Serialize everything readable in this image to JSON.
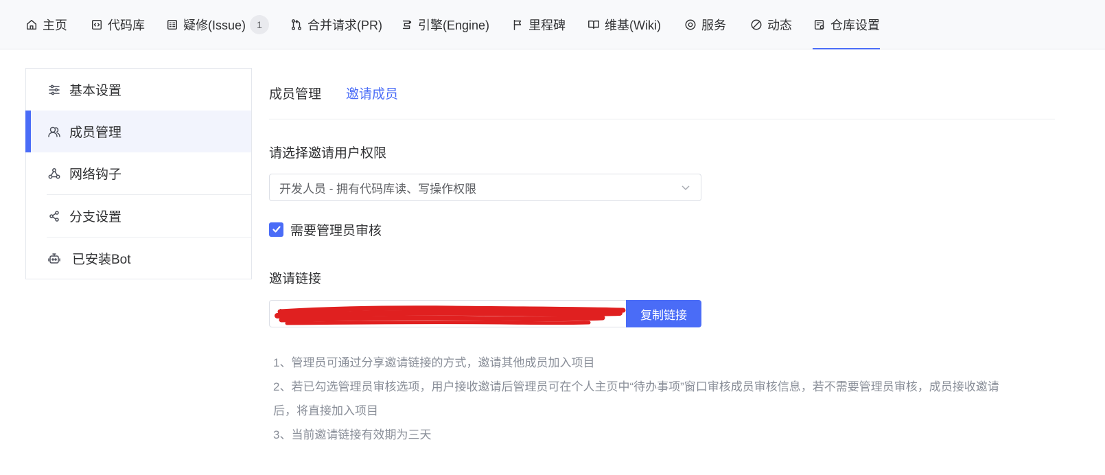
{
  "nav": {
    "items": [
      {
        "label": "主页",
        "icon": "home-icon"
      },
      {
        "label": "代码库",
        "icon": "code-icon"
      },
      {
        "label": "疑修(Issue)",
        "icon": "issue-icon",
        "badge": "1"
      },
      {
        "label": "合并请求(PR)",
        "icon": "pull-request-icon"
      },
      {
        "label": "引擎(Engine)",
        "icon": "engine-icon"
      },
      {
        "label": "里程碑",
        "icon": "flag-icon"
      },
      {
        "label": "维基(Wiki)",
        "icon": "book-icon"
      },
      {
        "label": "服务",
        "icon": "service-icon"
      },
      {
        "label": "动态",
        "icon": "activity-icon"
      },
      {
        "label": "仓库设置",
        "icon": "settings-icon",
        "active": true
      }
    ]
  },
  "sidebar": {
    "items": [
      {
        "label": "基本设置",
        "icon": "sliders-icon"
      },
      {
        "label": "成员管理",
        "icon": "members-icon",
        "active": true
      },
      {
        "label": "网络钩子",
        "icon": "webhook-icon"
      },
      {
        "label": "分支设置",
        "icon": "branch-icon"
      },
      {
        "label": "已安装Bot",
        "icon": "bot-icon"
      }
    ]
  },
  "main": {
    "tabs": [
      {
        "label": "成员管理"
      },
      {
        "label": "邀请成员",
        "active": true
      }
    ],
    "permission_label": "请选择邀请用户权限",
    "permission_value": "开发人员 - 拥有代码库读、写操作权限",
    "require_review_label": "需要管理员审核",
    "require_review_checked": true,
    "invite_link_label": "邀请链接",
    "invite_link_value": "http://",
    "copy_button_label": "复制链接",
    "notes": [
      "1、管理员可通过分享邀请链接的方式，邀请其他成员加入项目",
      "2、若已勾选管理员审核选项，用户接收邀请后管理员可在个人主页中“待办事项”窗口审核成员审核信息，若不需要管理员审核，成员接收邀请",
      "后，将直接加入项目",
      "3、当前邀请链接有效期为三天"
    ]
  },
  "colors": {
    "accent": "#4a6cf7",
    "redaction": "#e02020"
  }
}
